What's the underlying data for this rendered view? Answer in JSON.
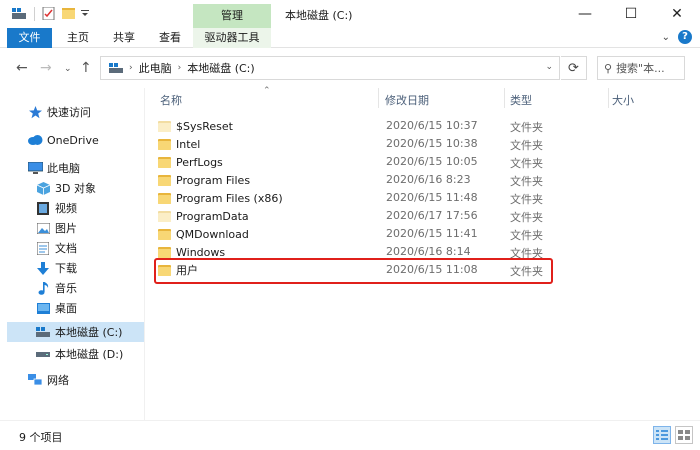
{
  "window": {
    "title": "本地磁盘 (C:)",
    "manage_tab": "管理",
    "controls": {
      "minimize": "—",
      "maximize": "☐",
      "close": "✕"
    }
  },
  "ribbon": {
    "tabs": [
      "文件",
      "主页",
      "共享",
      "查看"
    ],
    "contextual_tab": "驱动器工具"
  },
  "address": {
    "segments": [
      "此电脑",
      "本地磁盘 (C:)"
    ],
    "search_placeholder": "搜索\"本..."
  },
  "sidebar": {
    "items": [
      {
        "label": "快速访问",
        "icon": "star-icon"
      },
      {
        "label": "OneDrive",
        "icon": "cloud-icon"
      },
      {
        "label": "此电脑",
        "icon": "computer-icon"
      },
      {
        "label": "3D 对象",
        "icon": "cube-icon"
      },
      {
        "label": "视频",
        "icon": "video-icon"
      },
      {
        "label": "图片",
        "icon": "pictures-icon"
      },
      {
        "label": "文档",
        "icon": "documents-icon"
      },
      {
        "label": "下载",
        "icon": "download-icon"
      },
      {
        "label": "音乐",
        "icon": "music-icon"
      },
      {
        "label": "桌面",
        "icon": "desktop-icon"
      },
      {
        "label": "本地磁盘 (C:)",
        "icon": "drive-icon",
        "selected": true
      },
      {
        "label": "本地磁盘 (D:)",
        "icon": "drive-icon"
      },
      {
        "label": "网络",
        "icon": "network-icon"
      }
    ]
  },
  "columns": {
    "name": "名称",
    "date": "修改日期",
    "type": "类型",
    "size": "大小"
  },
  "files": [
    {
      "name": "$SysReset",
      "date": "2020/6/15 10:37",
      "type": "文件夹",
      "faded": true
    },
    {
      "name": "Intel",
      "date": "2020/6/15 10:38",
      "type": "文件夹"
    },
    {
      "name": "PerfLogs",
      "date": "2020/6/15 10:05",
      "type": "文件夹"
    },
    {
      "name": "Program Files",
      "date": "2020/6/16 8:23",
      "type": "文件夹"
    },
    {
      "name": "Program Files (x86)",
      "date": "2020/6/15 11:48",
      "type": "文件夹"
    },
    {
      "name": "ProgramData",
      "date": "2020/6/17 17:56",
      "type": "文件夹",
      "faded": true
    },
    {
      "name": "QMDownload",
      "date": "2020/6/15 11:41",
      "type": "文件夹"
    },
    {
      "name": "Windows",
      "date": "2020/6/16 8:14",
      "type": "文件夹"
    },
    {
      "name": "用户",
      "date": "2020/6/15 11:08",
      "type": "文件夹",
      "highlighted": true
    }
  ],
  "status": {
    "item_count": "9 个项目"
  },
  "colors": {
    "accent": "#1979ca",
    "manage_green": "#c5e6c1",
    "selection": "#cce4f7",
    "highlight_border": "#e0201b",
    "folder": "#f8d775"
  }
}
